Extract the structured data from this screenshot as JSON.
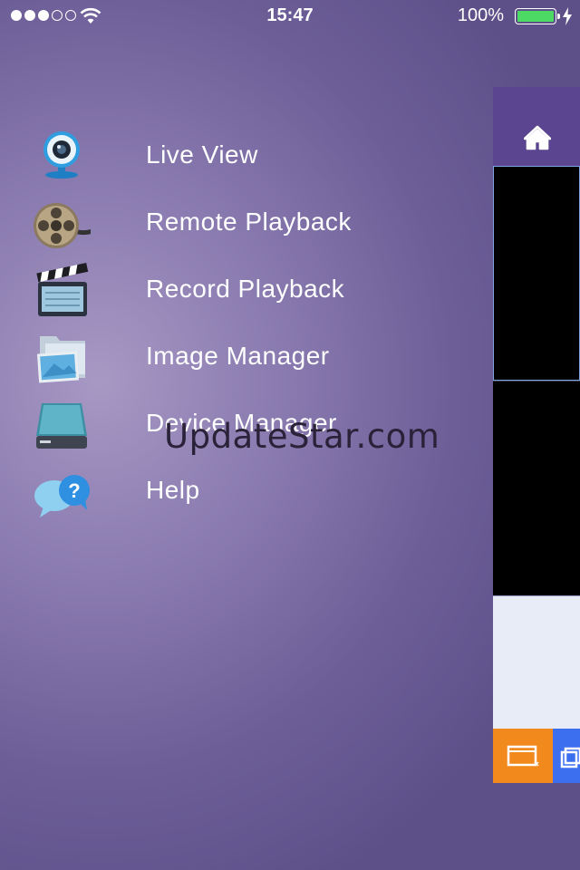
{
  "status_bar": {
    "time": "15:47",
    "battery_percent": "100%",
    "signal_bars_filled": 3,
    "signal_bars_total": 5,
    "battery_color": "#4cd964"
  },
  "menu": {
    "items": [
      {
        "label": "Live View",
        "icon": "webcam-icon"
      },
      {
        "label": "Remote Playback",
        "icon": "film-reel-icon"
      },
      {
        "label": "Record Playback",
        "icon": "clapperboard-icon"
      },
      {
        "label": "Image Manager",
        "icon": "image-folder-icon"
      },
      {
        "label": "Device Manager",
        "icon": "hard-drive-icon"
      },
      {
        "label": "Help",
        "icon": "help-bubble-icon"
      }
    ]
  },
  "watermark": "UpdateStar.com",
  "panel": {
    "header_color": "#5b4590",
    "home_icon": "home-icon",
    "action_colors": [
      "#f2891c",
      "#3c6ef0"
    ]
  }
}
